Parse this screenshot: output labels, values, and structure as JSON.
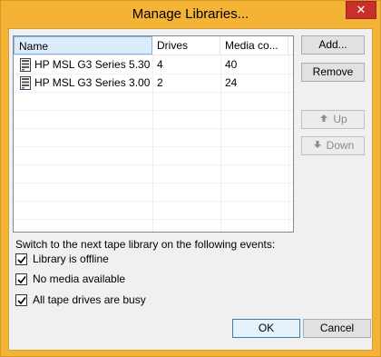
{
  "window": {
    "title": "Manage Libraries...",
    "close_label": "✕"
  },
  "list": {
    "columns": [
      "Name",
      "Drives",
      "Media co..."
    ],
    "rows": [
      {
        "name": "HP MSL G3 Series 5.30...",
        "drives": "4",
        "media": "40"
      },
      {
        "name": "HP MSL G3 Series 3.00...",
        "drives": "2",
        "media": "24"
      }
    ]
  },
  "buttons": {
    "add": "Add...",
    "remove": "Remove",
    "up": "Up",
    "down": "Down",
    "ok": "OK",
    "cancel": "Cancel"
  },
  "events": {
    "label": "Switch to the next tape library on the following events:",
    "options": [
      {
        "label": "Library is offline",
        "checked": true
      },
      {
        "label": "No media available",
        "checked": true
      },
      {
        "label": "All tape drives are busy",
        "checked": true
      }
    ]
  },
  "icons": {
    "library": "tape-library-icon",
    "up": "arrow-up-icon",
    "down": "arrow-down-icon",
    "check": "checkmark-icon"
  },
  "colors": {
    "title_bar": "#f4b335",
    "close": "#c7302b",
    "selection": "#dcecfc"
  }
}
